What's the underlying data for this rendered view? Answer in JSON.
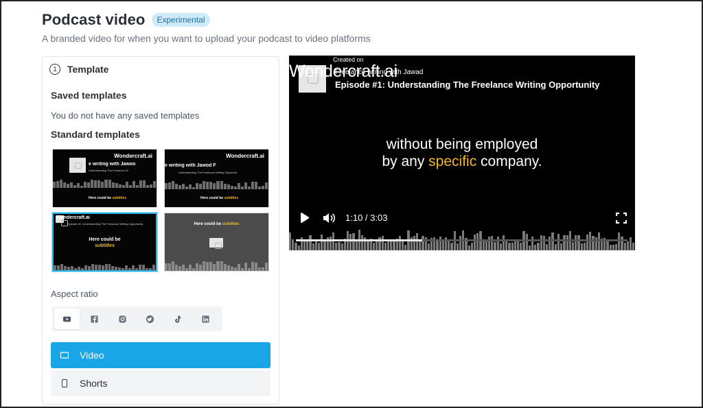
{
  "header": {
    "title": "Podcast video",
    "badge": "Experimental",
    "subtitle": "A branded video for when you want to upload your podcast to video platforms"
  },
  "panel": {
    "step_number": "1",
    "step_label": "Template",
    "saved_heading": "Saved templates",
    "saved_empty": "You do not have any saved templates",
    "standard_heading": "Standard templates",
    "templates": [
      {
        "brand": "Wondercraft.ai",
        "title": "e writing with Jawoo",
        "episode": "Understanding The Freelance W",
        "caption_prefix": "Here could be ",
        "caption_highlight": "subtitles"
      },
      {
        "brand": "Wondercraft.ai",
        "title": "e writing with Jawod  F",
        "episode": "Understanding The Freelance Writing Opportunt",
        "caption_prefix": "Here could be ",
        "caption_highlight": "subtitles"
      },
      {
        "brand": "Wondercraft.ai",
        "episode": "Episode #1: Understanding The Freelance Writing Opportunity",
        "caption_prefix": "Here could be",
        "caption_highlight": "subtitles"
      },
      {
        "caption_prefix": "Here could be ",
        "caption_highlight": "subtitles"
      }
    ],
    "aspect_label": "Aspect ratio",
    "aspect_icons": [
      "youtube-icon",
      "facebook-icon",
      "instagram-icon",
      "twitter-icon",
      "tiktok-icon",
      "linkedin-icon"
    ],
    "options": [
      {
        "label": "Video",
        "selected": true
      },
      {
        "label": "Shorts",
        "selected": false
      }
    ]
  },
  "player": {
    "created_on": "Created on",
    "brand": "Wondercraft.ai",
    "author": "Freelance writing with Jawad",
    "episode": "Episode #1: Understanding The Freelance Writing Opportunity",
    "line1": "without being employed",
    "line2_prefix": "by any ",
    "line2_highlight": "specific",
    "line2_suffix": " company.",
    "time": "1:10 / 3:03",
    "progress": 0.38
  },
  "colors": {
    "accent": "#1aa5e6",
    "badge_bg": "#cfeaf9",
    "highlight": "#f5b723"
  }
}
